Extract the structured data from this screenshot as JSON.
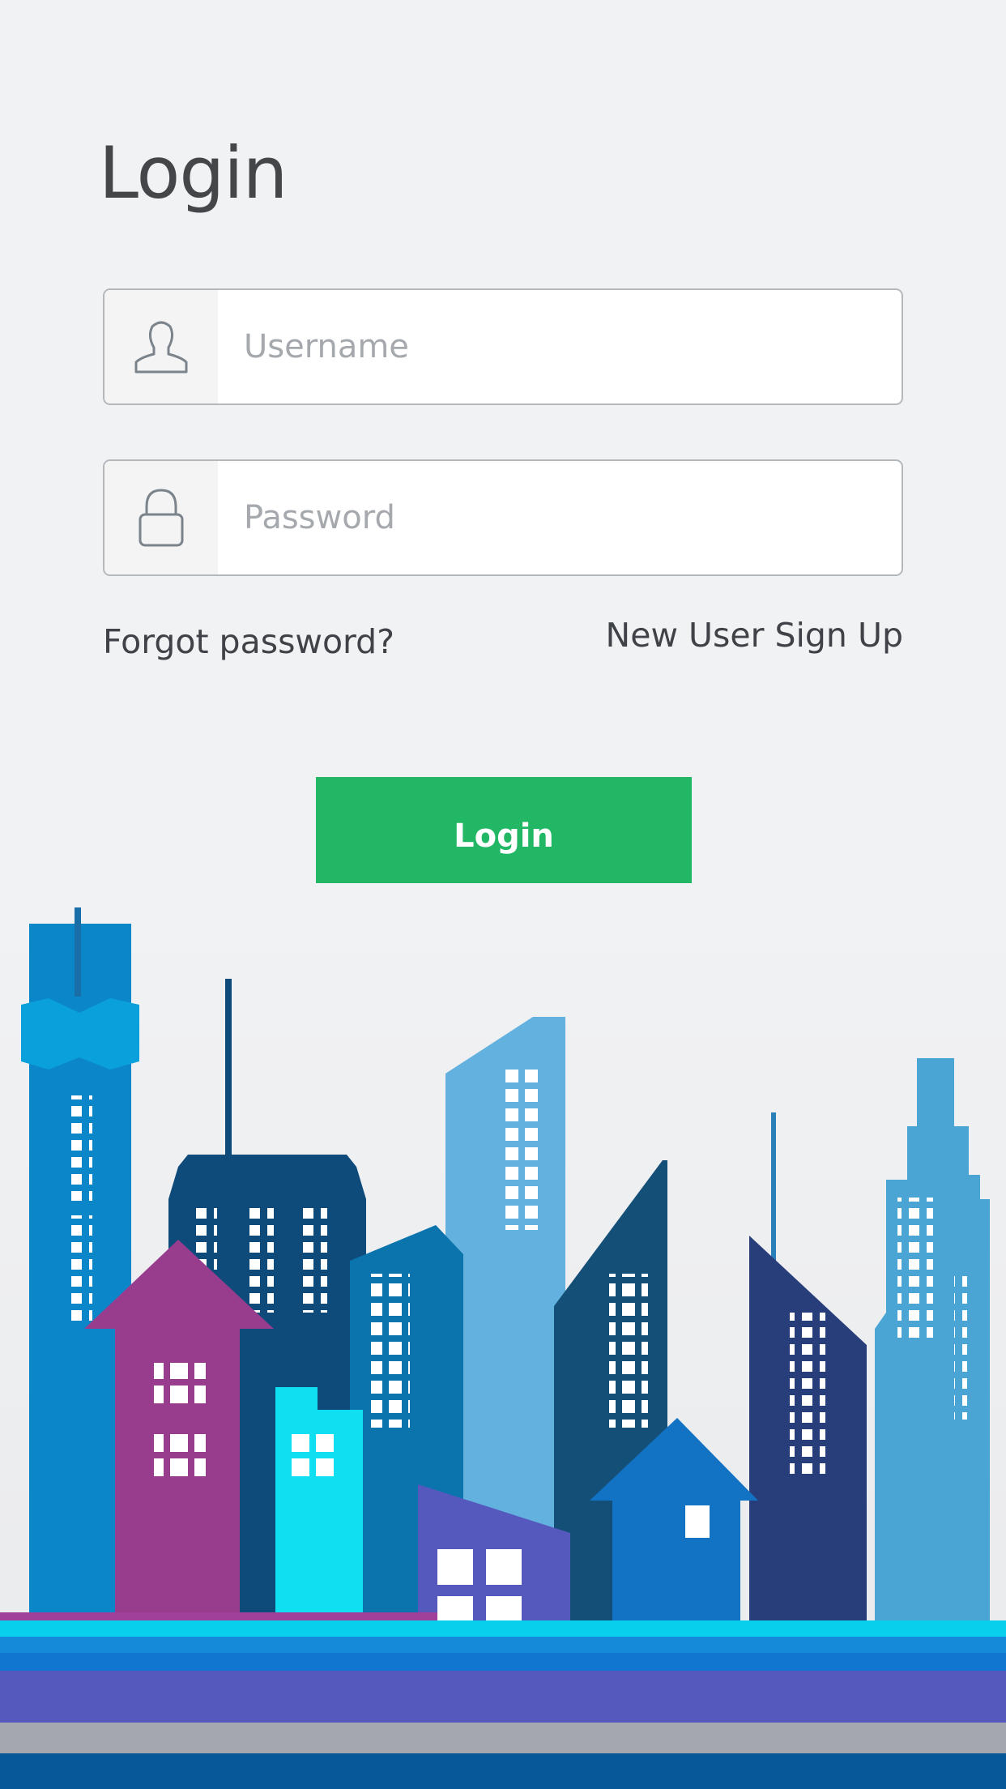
{
  "login": {
    "title": "Login",
    "username_placeholder": "Username",
    "password_placeholder": "Password",
    "forgot_password": "Forgot password?",
    "sign_up": "New User Sign Up",
    "button_label": "Login"
  },
  "icons": {
    "username": "user-icon",
    "password": "lock-icon"
  },
  "colors": {
    "background": "#f1f2f4",
    "button": "#22b765",
    "button_text": "#ffffff",
    "title_text": "#444649"
  }
}
